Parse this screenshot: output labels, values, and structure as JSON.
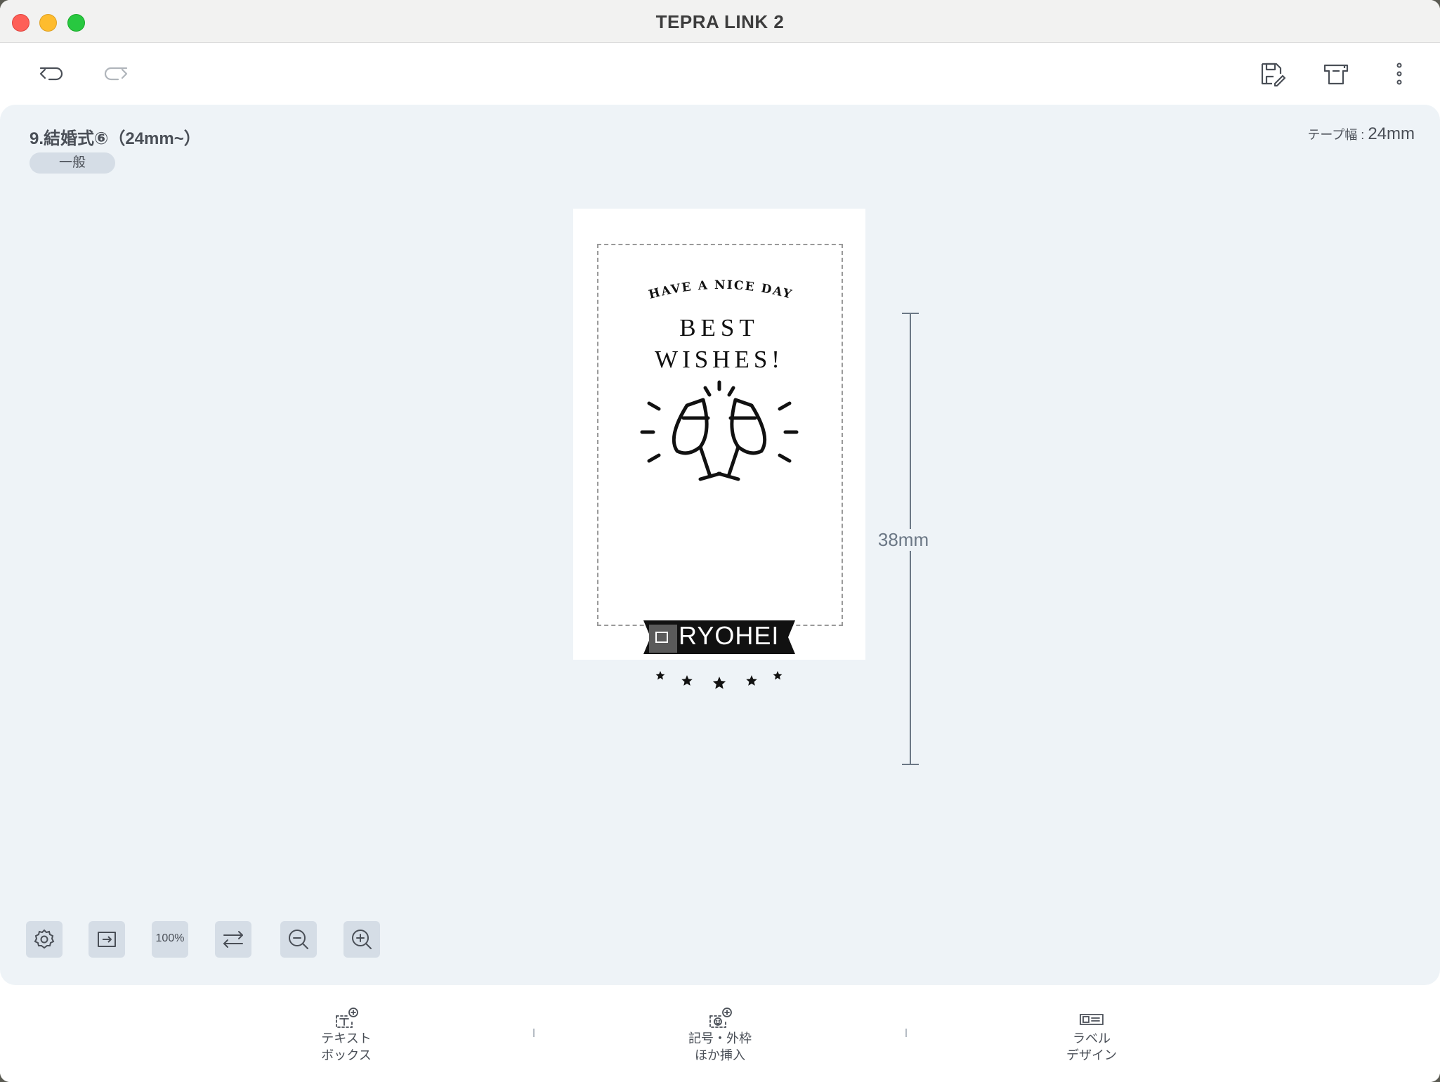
{
  "window": {
    "title": "TEPRA LINK 2"
  },
  "toolbar": {
    "icons": [
      "undo-icon",
      "redo-icon",
      "save-edit-icon",
      "print-icon",
      "more-vertical-icon"
    ]
  },
  "label_info": {
    "template_name": "9.結婚式⑥（24mm~）",
    "category": "一般",
    "tape_width_label": "テープ幅 : ",
    "tape_width_value": "24mm",
    "length": "38mm"
  },
  "label_content": {
    "arc_text": "HAVE A NICE DAY",
    "line1": "BEST",
    "line2": "WISHES!",
    "name": "RYOHEI"
  },
  "bottom_tools": {
    "zoom": "100%",
    "icons": [
      "settings-gear-icon",
      "fit-to-window-icon",
      "zoom-100-button",
      "swap-orientation-icon",
      "zoom-out-icon",
      "zoom-in-icon"
    ]
  },
  "bottom_bar": {
    "text_box_line1": "テキスト",
    "text_box_line2": "ボックス",
    "insert_line1": "記号・外枠",
    "insert_line2": "ほか挿入",
    "design_line1": "ラベル",
    "design_line2": "デザイン"
  },
  "colors": {
    "canvas_bg": "#eef3f7",
    "badge_bg": "#d5dde6",
    "text": "#4a4f57",
    "close": "#fe5f57",
    "minimize": "#febc2e",
    "maximize": "#28c840"
  }
}
